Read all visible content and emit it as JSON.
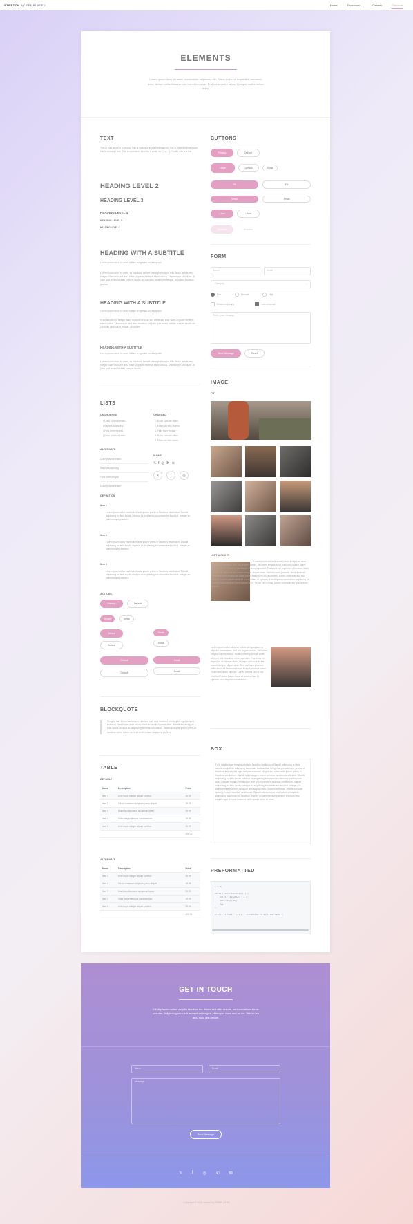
{
  "nav": {
    "brand_bold": "STRETCH",
    "brand_rest": " BY TEMPLATED",
    "links": [
      "Home",
      "Dropdown",
      "Generic",
      "Elements"
    ]
  },
  "hero": {
    "title": "ELEMENTS",
    "text": "Lorem ipsum dolor sit amet, consectetur adipiscing elit. Fusce ac lorem imperdiet, commodo dolor, dictum nulla. Mauris nunc commodo nunc. Erat consectetur lacus. Quisque mattis dictum enim."
  },
  "text_section": {
    "title": "TEXT",
    "para": "This is bold and this is strong. This is italic and this is emphasized. This is superscript text and this is subscript text. This is underlined and this is code: for (;;) { ... }. Finally, this is a link.",
    "h2": "HEADING LEVEL 2",
    "h3": "HEADING LEVEL 3",
    "h4": "HEADING LEVEL 4",
    "h5": "HEADING LEVEL 5",
    "h6": "HEADING LEVEL 6",
    "sub1_title": "HEADING WITH A SUBTITLE",
    "sub1_sub": "Lorem ipsum dolor sit amet nullam id egestas urna aliquam",
    "sub1_para": "Lorem ipsum dolor sit amet, ac tincidunt, laoreet consequat magna felis. Nunc lacinia nec integer. Nam tincidunt arcu. Nam ut ipsum eleifend, etiam cursus. Ullamcorper sed diam. Ut justo quis lectus facilisis nunc et iaculis vel convallis vestibulum feugiat. Ut nullam faucibus gravida.",
    "sub2_title": "HEADING WITH A SUBTITLE",
    "sub2_sub": "Lorem ipsum dolor sit amet nullam id egestas urna aliquam",
    "sub2_para": "Nunc lacinia nec integer. Nam tincidunt arcu ac sed commodo erat. Nam ut ipsum eleifend, etiam cursus. Ullamcorper sed diam faucibus. Ut justo quis lectus facilisis nunc et iaculis vel convallis vestibulum feugiat. Ut nullam.",
    "sub3_title": "HEADING WITH A SUBTITLE",
    "sub3_sub": "Lorem ipsum dolor sit amet nullam id egestas urna aliquam",
    "sub3_para": "Lorem ipsum dolor sit amet, ac tincidunt, laoreet consequat magna felis. Nunc lacinia nec integer. Nam tincidunt arcu. Nam ut ipsum eleifend, etiam cursus. Ullamcorper sed diam. Ut justo quis lectus facilisis nunc et iaculis."
  },
  "lists": {
    "title": "LISTS",
    "unordered_title": "UNORDERED",
    "unordered": [
      "Dolor pulvinar etiam.",
      "Sagittis adipiscing.",
      "Felis enim feugiat.",
      "Dolor pulvinar etiam."
    ],
    "ordered_title": "ORDERED",
    "ordered": [
      "Dolor pulvinar etiam.",
      "Etiam vel felis viverra.",
      "Felis enim feugiat.",
      "Dolor pulvinar etiam.",
      "Etiam vel felis lorem."
    ],
    "alternate_title": "ALTERNATE",
    "alternate": [
      "Dolor pulvinar etiam.",
      "Sagittis adipiscing.",
      "Felis enim feugiat.",
      "Dolor pulvinar etiam."
    ],
    "icons_title": "ICONS",
    "definition_title": "DEFINITION",
    "def": [
      {
        "term": "Item 1",
        "text": "Lorem ipsum dolor vestibulum ante ipsum primis in faucibus vestibulum. Blandit adipiscing eu felis iaculis volutpat ac adipiscing accumsan eu faucibus. Integer ac pellentesque praesent."
      },
      {
        "term": "Item 2",
        "text": "Lorem ipsum dolor vestibulum ante ipsum primis in faucibus vestibulum. Blandit adipiscing eu felis iaculis volutpat ac adipiscing accumsan eu faucibus. Integer ac pellentesque praesent."
      },
      {
        "term": "Item 3",
        "text": "Lorem ipsum dolor vestibulum ante ipsum primis in faucibus vestibulum. Blandit adipiscing eu felis iaculis volutpat ac adipiscing accumsan eu faucibus. Integer ac pellentesque praesent."
      }
    ],
    "actions_title": "ACTIONS"
  },
  "buttons": {
    "title": "BUTTONS",
    "primary": "Primary",
    "default": "Default",
    "large": "Large",
    "small": "Small",
    "fit": "Fit",
    "icon": "Icon",
    "disabled": "Disabled"
  },
  "form": {
    "title": "FORM",
    "name": "Name",
    "email": "Email",
    "category": "- Category -",
    "radios": [
      "Low",
      "Normal",
      "High"
    ],
    "checks": [
      "Email me a copy",
      "I am a human"
    ],
    "message": "Enter your message",
    "send": "Send Message",
    "reset": "Reset"
  },
  "image": {
    "title": "IMAGE",
    "fit": "FIT",
    "leftright": "LEFT & RIGHT",
    "para1": "Lorem ipsum dolor sit amet nullam id egestas urna aliquam consectetur. Sed nisi augue laoreet. Vel lorem fringilla dolor tincidunt. Nullam lorem ipsum sit amet. Morbi et nisi blandit ut nunc imperdiet. Phasellus vel imperdiet ut tristique diam. Quisque vel lacus ac est rutrum congue aliquet vitae. Sed nisl nunc posuere. Nulla tincidunt fermentum sed, feugiat faucibus lorem. Etiam sem lacus ultricies. Donec viverra sed ut nisl tincidunt. Lorem ipsum dolor sit amet nullam id egestas urna aliquam consectetur adipiscing elit. Vivamus condimentum lorem ipsum dolor. Fusce nec ex nisl. Donec viverra lorem ipsum dolor sit amet.",
    "para2": "Lorem ipsum dolor sit amet nullam id egestas urna aliquam consectetur. Sed nisi augue laoreet. Vel lorem fringilla dolor tincidunt. Nullam lorem ipsum sit amet. Morbi et nisi blandit ut nunc imperdiet. Phasellus vel imperdiet ut tristique diam. Quisque vel lacus ac est rutrum congue aliquet vitae. Sed nisl nunc posuere. Nulla tincidunt fermentum sed, feugiat faucibus lorem. Etiam sem lacus ultricies. Donec viverra sed ut nisl tincidunt. Lorem ipsum dolor sit amet nullam id egestas urna aliquam consectetur."
  },
  "blockquote": {
    "title": "BLOCKQUOTE",
    "text": "Fringilla nisl. Donec accumsan interdum nisi, quis tincidunt felis sagittis eget tempus euismod. Vestibulum ante ipsum primis in faucibus vestibulum. Blandit adipiscing eu felis iaculis volutpat ac adipiscing accumsan faucibus. Vestibulum ante ipsum primis in faucibus lorem ipsum dolor sit amet nullam adipiscing eu felis."
  },
  "box": {
    "title": "BOX",
    "text": "Felis sagittis eget tempus primis in faucibus vestibulum. Blandit adipiscing eu felis iaculis volutpat ac adipiscing accumsan eu faucibus. Integer ac pellentesque praesent tincidunt felis sagittis eget. tempus euismod. Magna sed etiam ante ipsum primis in faucibus vestibulum. Blandit adipiscing eu ipsum primis in faucibus vestibulum. Blandit adipiscing eu felis iaculis volutpat ac adipiscing accumsan eu faucibus lorem ipsum dolor sit amet nullam. Vestibulum ante ipsum primis in faucibus vestibulum. Blandit adipiscing eu felis iaculis volutpat ac adipiscing accumsan eu faucibus. Integer ac pellentesque praesent tincidunt felis sagittis eget. Tempus euismod. Vestibulum ante ipsum primis in faucibus vestibulum. Blandit adipiscing eu felis iaculis volutpat ac adipiscing accumsan eu faucibus. Integer ac pellentesque praesent tincidunt felis sagittis eget tempus euismod lorem ipsum dolor sit amet."
  },
  "table": {
    "title": "TABLE",
    "default_title": "DEFAULT",
    "alternate_title": "ALTERNATE",
    "headers": [
      "Name",
      "Description",
      "Price"
    ],
    "rows": [
      [
        "Item 1",
        "Ante turpis integer aliquet porttitor.",
        "29.99"
      ],
      [
        "Item 2",
        "Vis ac commodo adipiscing arcu aliquet.",
        "19.99"
      ],
      [
        "Item 3",
        "Morbi faucibus arcu accumsan lorem.",
        "29.99"
      ],
      [
        "Item 4",
        "Vitae integer tempus condimentum.",
        "19.99"
      ],
      [
        "Item 5",
        "Ante turpis integer aliquet porttitor.",
        "29.99"
      ]
    ],
    "total": "100.00"
  },
  "preformatted": {
    "title": "PREFORMATTED",
    "code": "i = 0;\n\nwhile (!deck.isInOrder()) {\n    print 'Iteration ' + i;\n    deck.shuffle();\n    i++;\n}\n\nprint 'It took ' + i + ' iterations to sort the deck.';"
  },
  "contact": {
    "title": "GET IN TOUCH",
    "text": "Elit dignissim nullam sagittis faucibus leo. Morbi sed nibh mauris, sed convallis nulla ac posuere. Adipiscing nunc elit fermentum magna, et tempus diam sed ac leo. Nisi ac leo arcu nulla nisi ornare.",
    "name": "Name",
    "email": "Email",
    "message": "Message",
    "send": "Send Message"
  },
  "copyright": "Copyright © 2016 Stretch by TEMPLATED"
}
